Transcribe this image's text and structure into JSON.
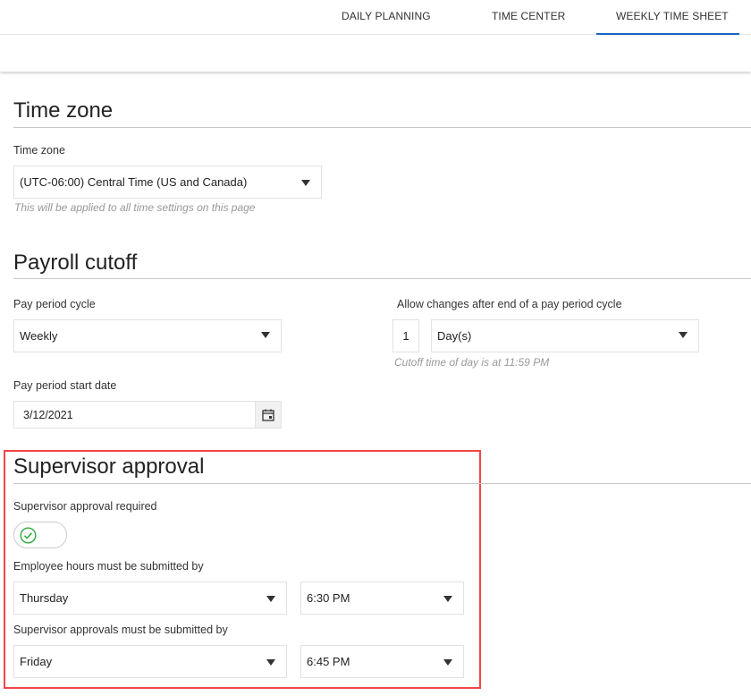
{
  "tabs": [
    {
      "label": "DAILY PLANNING"
    },
    {
      "label": "TIME CENTER"
    },
    {
      "label": "WEEKLY TIME SHEET",
      "active": true
    }
  ],
  "timezone": {
    "title": "Time zone",
    "label": "Time zone",
    "value": "(UTC-06:00) Central Time (US and Canada)",
    "hint": "This will be applied to all time settings on this page"
  },
  "payroll": {
    "title": "Payroll cutoff",
    "cycle_label": "Pay period cycle",
    "cycle_value": "Weekly",
    "allow_label": "Allow changes after end of a pay period cycle",
    "allow_count": "1",
    "allow_unit": "Day(s)",
    "cutoff_hint": "Cutoff time of day is at 11:59 PM",
    "start_label": "Pay period start date",
    "start_value": "3/12/2021"
  },
  "supervisor": {
    "title": "Supervisor approval",
    "required_label": "Supervisor approval required",
    "required_on": true,
    "employee_label": "Employee hours must be submitted by",
    "employee_day": "Thursday",
    "employee_time": "6:30 PM",
    "approval_label": "Supervisor approvals must be submitted by",
    "approval_day": "Friday",
    "approval_time": "6:45 PM"
  },
  "colors": {
    "accent": "#1565c0",
    "highlight": "#f0464a",
    "toggle_check": "#2eaa3c"
  }
}
